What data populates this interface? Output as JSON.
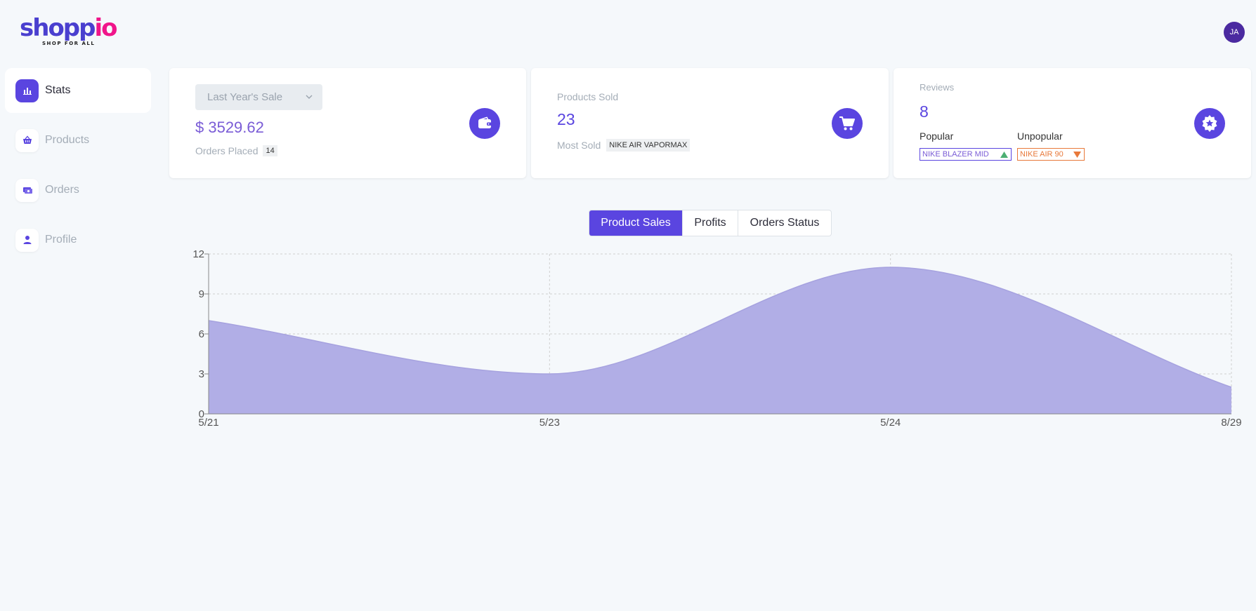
{
  "brand": {
    "logo_part1": "shopp",
    "logo_part2": "io",
    "tagline": "SHOP FOR ALL",
    "primary_color": "#5a45e0",
    "accent_color": "#f0158a"
  },
  "user": {
    "initials": "JA"
  },
  "sidebar": {
    "items": [
      {
        "label": "Stats",
        "icon": "bar-chart-icon",
        "active": true
      },
      {
        "label": "Products",
        "icon": "basket-icon",
        "active": false
      },
      {
        "label": "Orders",
        "icon": "money-icon",
        "active": false
      },
      {
        "label": "Profile",
        "icon": "user-icon",
        "active": false
      }
    ]
  },
  "cards": {
    "sales": {
      "period_select": "Last Year's Sale",
      "amount": "$ 3529.62",
      "orders_label": "Orders Placed",
      "orders_count": "14",
      "icon": "wallet-icon"
    },
    "products": {
      "title": "Products Sold",
      "value": "23",
      "most_sold_label": "Most Sold",
      "most_sold_product": "NIKE AIR VAPORMAX",
      "icon": "cart-icon"
    },
    "reviews": {
      "title": "Reviews",
      "value": "8",
      "popular_label": "Popular",
      "unpopular_label": "Unpopular",
      "popular_product": "NIKE BLAZER MID",
      "unpopular_product": "NIKE AIR 90",
      "icon": "star-badge-icon"
    }
  },
  "tabs": [
    {
      "label": "Product Sales",
      "active": true
    },
    {
      "label": "Profits",
      "active": false
    },
    {
      "label": "Orders Status",
      "active": false
    }
  ],
  "chart_data": {
    "type": "area",
    "categories": [
      "5/21",
      "5/23",
      "5/24",
      "8/29"
    ],
    "series": [
      {
        "values": [
          7,
          3,
          11,
          2
        ],
        "color": "#b1aee6"
      }
    ],
    "ylim": [
      0,
      12
    ],
    "yticks": [
      0,
      3,
      6,
      9,
      12
    ],
    "grid": true
  }
}
